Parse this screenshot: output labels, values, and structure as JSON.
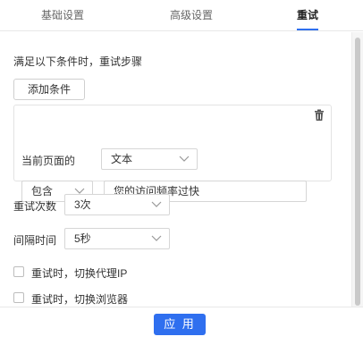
{
  "tabs": [
    {
      "label": "基础设置"
    },
    {
      "label": "高级设置"
    },
    {
      "label": "重试"
    }
  ],
  "retry": {
    "heading": "满足以下条件时，重试步骤",
    "add_condition_label": "添加条件",
    "condition": {
      "page_label": "当前页面的",
      "field_select": "文本",
      "operator_select": "包含",
      "value": "您的访问频率过快"
    },
    "retry_count": {
      "label": "重试次数",
      "value": "3次"
    },
    "interval": {
      "label": "间隔时间",
      "value": "5秒"
    },
    "switch_proxy": {
      "label": "重试时，切换代理IP",
      "checked": false
    },
    "switch_browser": {
      "label": "重试时，切换浏览器",
      "checked": false
    }
  },
  "footer": {
    "apply_label": "应 用"
  },
  "colors": {
    "accent": "#2f6fef"
  },
  "icons": [
    "trash-icon",
    "chevron-down-icon",
    "checkbox"
  ]
}
